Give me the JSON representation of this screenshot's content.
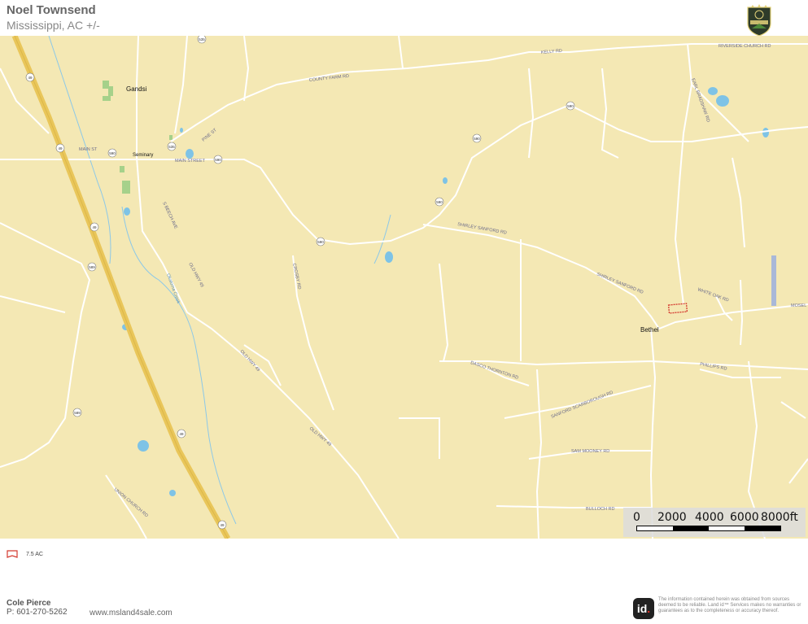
{
  "header": {
    "title": "Noel Townsend",
    "subtitle": "Mississippi,  AC +/-"
  },
  "logo": {
    "name": "Pearltree Land logo",
    "icon": "tree-shield-icon",
    "text": "PEARLTREE LAND PRO"
  },
  "map": {
    "places": {
      "gandsi": "Gandsi",
      "seminary": "Seminary",
      "bethel": "Bethel",
      "mosel": "MOSEL"
    },
    "roads": {
      "county_farm": "COUNTY FARM RD",
      "main_st": "MAIN ST",
      "main_street": "MAIN STREET",
      "pine_st": "PINE ST",
      "s_beech": "S BEECH AVE",
      "old_hwy_49_a": "OLD HWY 49",
      "old_hwy_49_b": "OLD HWY 49",
      "old_hwy_49_c": "OLD HWY 49",
      "shirley_sanford_a": "SHIRLEY SANFORD RD",
      "shirley_sanford_b": "SHIRLEY SANFORD RD",
      "earl_bradshaw": "EARL BRADSHAW RD",
      "riverside_church": "RIVERSIDE CHURCH RD",
      "crosby": "CROSBY RD",
      "dasco_thornton": "DASCO THORNTON RD",
      "sanford_scarborough": "SANFORD SCARBOROUGH RD",
      "sam_mooney": "SAM MOONEY RD",
      "bulloch": "BULLOCH RD",
      "phillips": "PHILLIPS RD",
      "union_church": "UNION CHURCH RD",
      "kelly": "KELLY RD",
      "white_oak": "WHITE OAK RD",
      "okatoma_creek": "Okatoma Creek"
    },
    "shields": {
      "us49_a": "49",
      "us49_b": "49",
      "us49_c": "49",
      "us49_d": "49",
      "us49_e": "49",
      "ms535_a": "535",
      "ms535_b": "535",
      "ms590_a": "590",
      "ms590_b": "590",
      "ms590_c": "590",
      "ms590_d": "590",
      "ms590_e": "590",
      "ms590_f": "590",
      "ms589_a": "589",
      "ms589_b": "589"
    }
  },
  "scale": {
    "labels": [
      "0",
      "2000",
      "4000",
      "6000",
      "8000ft"
    ]
  },
  "legend": {
    "label": "7.5 AC",
    "color": "#d43a2f"
  },
  "footer": {
    "agent_name": "Cole  Pierce",
    "agent_phone": "P: 601-270-5262",
    "website": "www.msland4sale.com",
    "id_logo": "id",
    "disclaimer": "The information contained herein was obtained from sources deemed to be reliable. Land id™ Services makes no warranties or guarantees as to the completeness or accuracy thereof."
  },
  "colors": {
    "land": "#f4e8b4",
    "highway": "#e9c65a",
    "road": "#ffffff",
    "water": "#7ec3e6",
    "park": "#a6d18a",
    "parcel": "#d43a2f"
  }
}
